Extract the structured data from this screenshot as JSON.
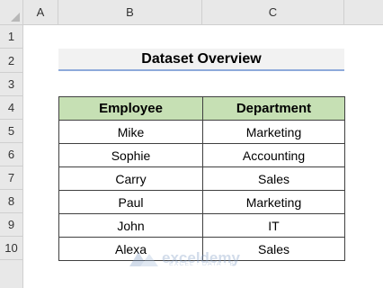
{
  "sheet": {
    "columns": [
      "A",
      "B",
      "C"
    ],
    "rows": [
      "1",
      "2",
      "3",
      "4",
      "5",
      "6",
      "7",
      "8",
      "9",
      "10"
    ]
  },
  "title": "Dataset Overview",
  "table": {
    "headers": [
      "Employee",
      "Department"
    ],
    "rows": [
      [
        "Mike",
        "Marketing"
      ],
      [
        "Sophie",
        "Accounting"
      ],
      [
        "Carry",
        "Sales"
      ],
      [
        "Paul",
        "Marketing"
      ],
      [
        "John",
        "IT"
      ],
      [
        "Alexa",
        "Sales"
      ]
    ]
  },
  "watermark": {
    "name": "exceldemy",
    "tagline": "EXCEL · DATA · BI"
  },
  "colors": {
    "header_fill": "#c6e0b4",
    "title_fill": "#f2f2f2",
    "title_underline": "#8eaadb"
  }
}
